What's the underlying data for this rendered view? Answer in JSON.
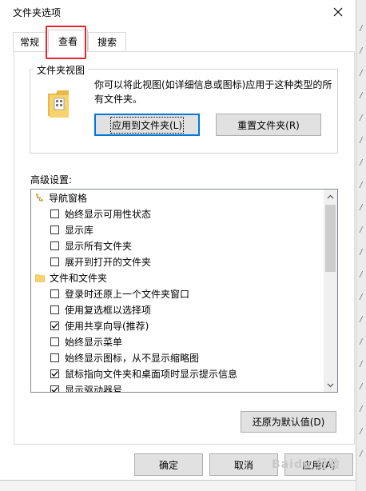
{
  "window": {
    "title": "文件夹选项",
    "close_icon": "close-icon"
  },
  "tabs": [
    {
      "label": "常规"
    },
    {
      "label": "查看",
      "active": true
    },
    {
      "label": "搜索"
    }
  ],
  "folder_views": {
    "legend": "文件夹视图",
    "description": "你可以将此视图(如详细信息或图标)应用于这种类型的所有文件夹。",
    "apply_button": "应用到文件夹(L)",
    "reset_button": "重置文件夹(R)"
  },
  "advanced": {
    "label": "高级设置:",
    "items": [
      {
        "type": "group",
        "label": "导航窗格",
        "icon": "navigation-pane-icon"
      },
      {
        "type": "checkbox",
        "label": "始终显示可用性状态",
        "checked": false
      },
      {
        "type": "checkbox",
        "label": "显示库",
        "checked": false
      },
      {
        "type": "checkbox",
        "label": "显示所有文件夹",
        "checked": false
      },
      {
        "type": "checkbox",
        "label": "展开到打开的文件夹",
        "checked": false
      },
      {
        "type": "group",
        "label": "文件和文件夹",
        "icon": "folder-icon"
      },
      {
        "type": "checkbox",
        "label": "登录时还原上一个文件夹窗口",
        "checked": false
      },
      {
        "type": "checkbox",
        "label": "使用复选框以选择项",
        "checked": false
      },
      {
        "type": "checkbox",
        "label": "使用共享向导(推荐)",
        "checked": true
      },
      {
        "type": "checkbox",
        "label": "始终显示菜单",
        "checked": false
      },
      {
        "type": "checkbox",
        "label": "始终显示图标，从不显示缩略图",
        "checked": false
      },
      {
        "type": "checkbox",
        "label": "鼠标指向文件夹和桌面项时显示提示信息",
        "checked": true
      },
      {
        "type": "checkbox",
        "label": "显示驱动器号",
        "checked": true
      }
    ],
    "restore_button": "还原为默认值(D)"
  },
  "footer": {
    "ok_button": "确定",
    "cancel_button": "取消",
    "apply_button": "应用(A)"
  },
  "watermark": "Baidu 经验",
  "colors": {
    "highlight": "#e5262b",
    "folder": "#f6d36b",
    "focus": "#0078d7"
  }
}
